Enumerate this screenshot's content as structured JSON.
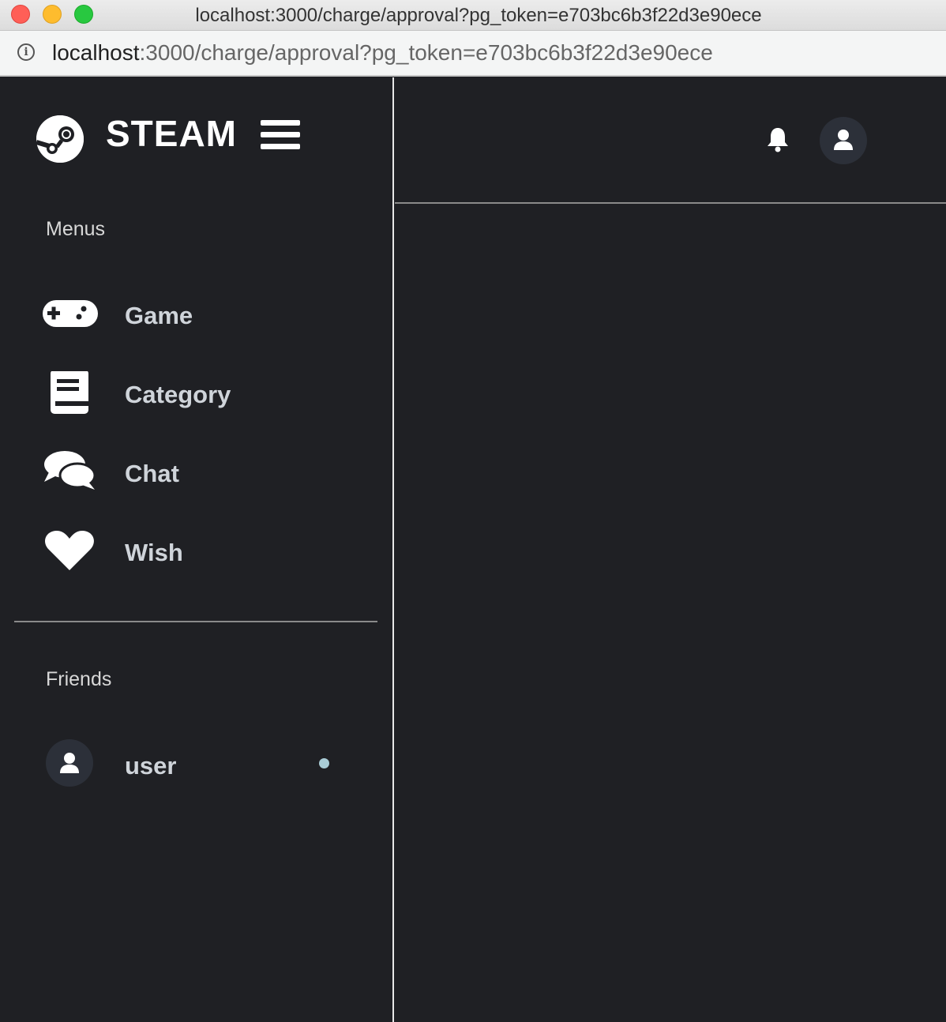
{
  "window": {
    "title": "localhost:3000/charge/approval?pg_token=e703bc6b3f22d3e90ece"
  },
  "address_bar": {
    "host": "localhost",
    "path": ":3000/charge/approval?pg_token=e703bc6b3f22d3e90ece",
    "icon": "info-icon"
  },
  "sidebar": {
    "brand": "STEAM",
    "menus_label": "Menus",
    "items": [
      {
        "label": "Game",
        "icon": "gamepad-icon"
      },
      {
        "label": "Category",
        "icon": "book-icon"
      },
      {
        "label": "Chat",
        "icon": "chat-bubbles-icon"
      },
      {
        "label": "Wish",
        "icon": "heart-icon"
      }
    ],
    "friends_label": "Friends",
    "friends": [
      {
        "name": "user",
        "status_color": "#a9ccd6"
      }
    ]
  },
  "header": {
    "notification_icon": "bell-icon",
    "profile_icon": "user-icon"
  },
  "colors": {
    "background": "#1f2024",
    "text": "#cfd4da",
    "avatar_bg": "#2c3039"
  }
}
